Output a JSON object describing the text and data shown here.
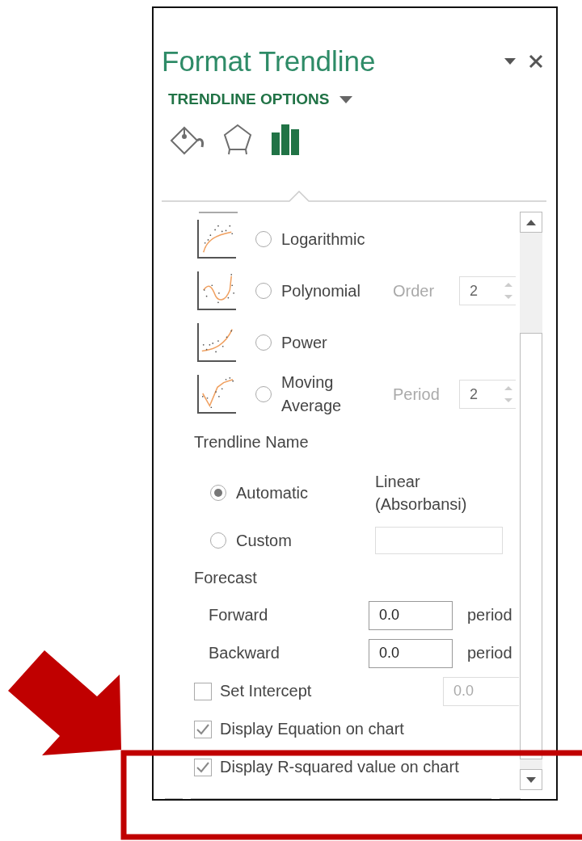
{
  "panel": {
    "title": "Format Trendline",
    "section": "TRENDLINE OPTIONS",
    "tabs": [
      {
        "kind": "fill",
        "selected": false
      },
      {
        "kind": "effects",
        "selected": false
      },
      {
        "kind": "options",
        "selected": true
      }
    ],
    "trend_types": [
      {
        "kind": "logarithmic",
        "label": "Logarithmic",
        "selected": false
      },
      {
        "kind": "polynomial",
        "label": "Polynomial",
        "selected": false,
        "option": {
          "label": "Order",
          "value": "2",
          "disabled": true
        }
      },
      {
        "kind": "power",
        "label": "Power",
        "selected": false
      },
      {
        "kind": "moving_average",
        "label": "Moving Average",
        "selected": false,
        "option": {
          "label": "Period",
          "value": "2",
          "disabled": true
        }
      }
    ],
    "trendline_name": {
      "heading": "Trendline Name",
      "options": [
        {
          "label": "Automatic",
          "selected": true,
          "value": "Linear (Absorbansi)"
        },
        {
          "label": "Custom",
          "selected": false
        }
      ]
    },
    "forecast": {
      "heading": "Forecast",
      "rows": [
        {
          "label": "Forward",
          "value": "0.0",
          "unit": "period"
        },
        {
          "label": "Backward",
          "value": "0.0",
          "unit": "period"
        }
      ]
    },
    "checks": [
      {
        "label": "Set Intercept",
        "checked": false,
        "value": "0.0",
        "disabled": true
      },
      {
        "label": "Display Equation on chart",
        "checked": true
      },
      {
        "label": "Display R-squared value on chart",
        "checked": true
      }
    ]
  }
}
